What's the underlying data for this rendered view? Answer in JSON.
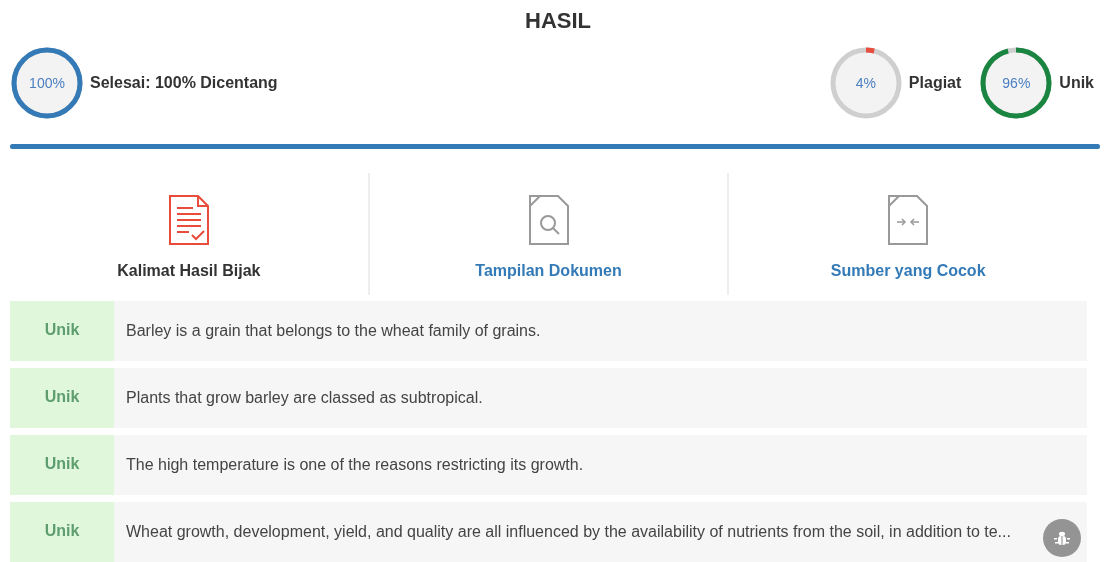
{
  "title": "HASIL",
  "summary": {
    "ring": {
      "value": "100%",
      "kind": "checked"
    },
    "label": "Selesai: 100% Dicentang"
  },
  "scores": [
    {
      "value": "4%",
      "kind": "plagiarism",
      "label": "Plagiat"
    },
    {
      "value": "96%",
      "kind": "unique",
      "label": "Unik"
    }
  ],
  "progress": {
    "level": 1
  },
  "tabs": [
    {
      "label": "Kalimat Hasil Bijak",
      "kind": "sentences",
      "selected": true
    },
    {
      "label": "Tampilan Dokumen",
      "kind": "document",
      "selected": false
    },
    {
      "label": "Sumber yang Cocok",
      "kind": "sources",
      "selected": false
    }
  ],
  "results": [
    {
      "status": "Unik",
      "text": "Barley is a grain that belongs to the wheat family of grains."
    },
    {
      "status": "Unik",
      "text": "Plants that grow barley are classed as subtropical."
    },
    {
      "status": "Unik",
      "text": "The high temperature is one of the reasons restricting its growth."
    },
    {
      "status": "Unik",
      "text": "Wheat growth, development, yield, and quality are all influenced by the availability of nutrients from the soil, in addition to te..."
    }
  ]
}
